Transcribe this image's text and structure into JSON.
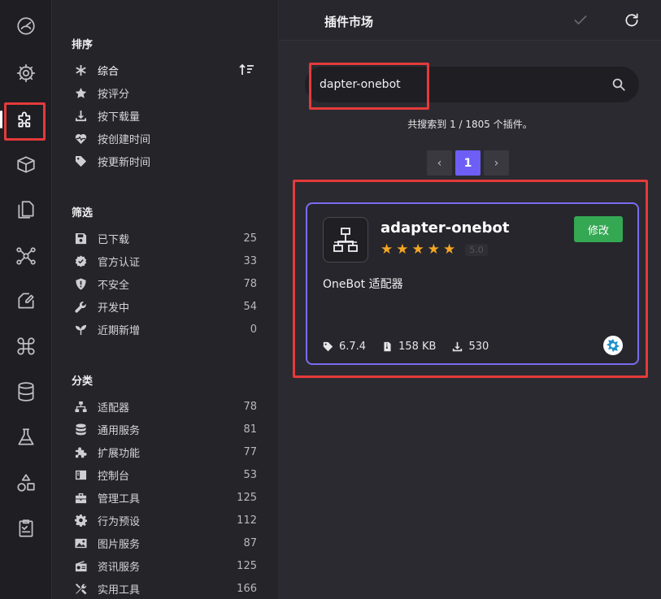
{
  "activity": {
    "items": [
      "dashboard-icon",
      "settings-icon",
      "plugins-icon",
      "package-icon",
      "files-icon",
      "network-icon",
      "edit-icon",
      "command-icon",
      "database-icon",
      "flask-icon",
      "shapes-icon",
      "clipboard-icon"
    ],
    "active": "plugins-icon"
  },
  "sidebar": {
    "sort": {
      "title": "排序",
      "items": [
        {
          "icon": "asterisk-icon",
          "label": "综合"
        },
        {
          "icon": "star-icon",
          "label": "按评分"
        },
        {
          "icon": "download-icon",
          "label": "按下载量"
        },
        {
          "icon": "heartbeat-icon",
          "label": "按创建时间"
        },
        {
          "icon": "tag-icon",
          "label": "按更新时间"
        }
      ]
    },
    "filter": {
      "title": "筛选",
      "items": [
        {
          "icon": "save-icon",
          "label": "已下载",
          "count": "25"
        },
        {
          "icon": "verified-icon",
          "label": "官方认证",
          "count": "33"
        },
        {
          "icon": "shield-alert-icon",
          "label": "不安全",
          "count": "78"
        },
        {
          "icon": "wrench-icon",
          "label": "开发中",
          "count": "54"
        },
        {
          "icon": "sprout-icon",
          "label": "近期新增",
          "count": "0"
        }
      ]
    },
    "category": {
      "title": "分类",
      "items": [
        {
          "icon": "network-icon",
          "label": "适配器",
          "count": "78"
        },
        {
          "icon": "database-icon",
          "label": "通用服务",
          "count": "81"
        },
        {
          "icon": "puzzle-icon",
          "label": "扩展功能",
          "count": "77"
        },
        {
          "icon": "console-icon",
          "label": "控制台",
          "count": "53"
        },
        {
          "icon": "toolbox-icon",
          "label": "管理工具",
          "count": "125"
        },
        {
          "icon": "gear-icon",
          "label": "行为预设",
          "count": "112"
        },
        {
          "icon": "image-icon",
          "label": "图片服务",
          "count": "87"
        },
        {
          "icon": "radio-icon",
          "label": "资讯服务",
          "count": "125"
        },
        {
          "icon": "tools-icon",
          "label": "实用工具",
          "count": "166"
        }
      ]
    }
  },
  "main": {
    "title": "插件市场",
    "search": {
      "value": "dapter-onebot",
      "placeholder": ""
    },
    "result": "共搜索到 1 / 1805 个插件。",
    "pager": {
      "prev": "‹",
      "current": "1",
      "next": "›"
    },
    "card": {
      "name": "adapter-onebot",
      "rating": 5,
      "rating_text": "5.0",
      "action": "修改",
      "description": "OneBot 适配器",
      "version": "6.7.4",
      "size": "158 KB",
      "downloads": "530"
    }
  },
  "colors": {
    "accent": "#6d5ff5",
    "card_border": "#7a6cf0",
    "edit_button": "#34a853",
    "star": "#f5a623",
    "highlight": "#e53a3a"
  }
}
